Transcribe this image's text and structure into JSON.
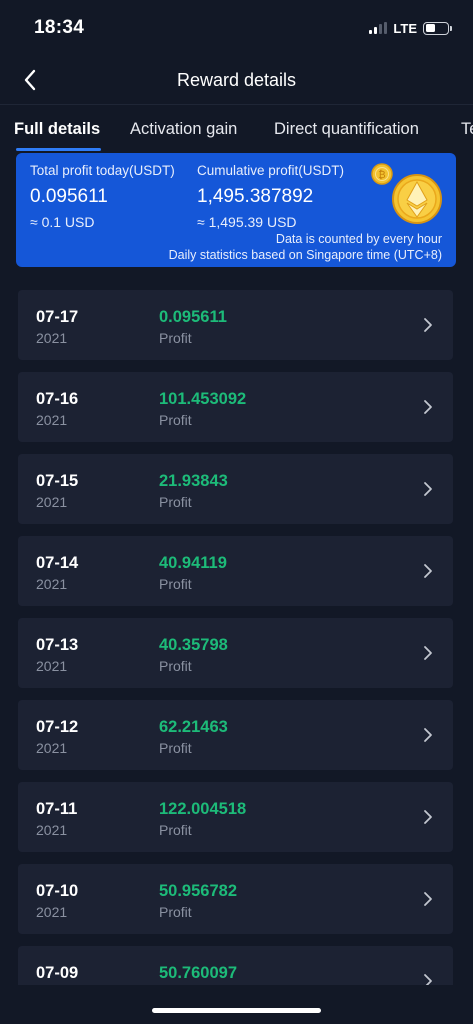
{
  "status": {
    "time": "18:34",
    "network": "LTE"
  },
  "nav": {
    "title": "Reward details"
  },
  "tabs": [
    {
      "label": "Full details"
    },
    {
      "label": "Activation gain"
    },
    {
      "label": "Direct quantification"
    },
    {
      "label": "Te"
    }
  ],
  "summary": {
    "today_label": "Total profit today(USDT)",
    "today_value": "0.095611",
    "today_usd": "≈ 0.1 USD",
    "cumulative_label": "Cumulative profit(USDT)",
    "cumulative_value": "1,495.387892",
    "cumulative_usd": "≈ 1,495.39 USD",
    "note_line1": "Data is counted by every hour",
    "note_line2": "Daily statistics based on Singapore time (UTC+8)"
  },
  "records": [
    {
      "date": "07-17",
      "year": "2021",
      "amount": "0.095611",
      "type": "Profit"
    },
    {
      "date": "07-16",
      "year": "2021",
      "amount": "101.453092",
      "type": "Profit"
    },
    {
      "date": "07-15",
      "year": "2021",
      "amount": "21.93843",
      "type": "Profit"
    },
    {
      "date": "07-14",
      "year": "2021",
      "amount": "40.94119",
      "type": "Profit"
    },
    {
      "date": "07-13",
      "year": "2021",
      "amount": "40.35798",
      "type": "Profit"
    },
    {
      "date": "07-12",
      "year": "2021",
      "amount": "62.21463",
      "type": "Profit"
    },
    {
      "date": "07-11",
      "year": "2021",
      "amount": "122.004518",
      "type": "Profit"
    },
    {
      "date": "07-10",
      "year": "2021",
      "amount": "50.956782",
      "type": "Profit"
    },
    {
      "date": "07-09",
      "year": "",
      "amount": "50.760097",
      "type": ""
    }
  ],
  "colors": {
    "background": "#121826",
    "card": "#1c2233",
    "summary_card": "#1557d8",
    "profit_green": "#1dbb79",
    "tab_indicator": "#2f7cf6"
  },
  "icons": {
    "back": "chevron-left-icon",
    "row": "chevron-right-icon",
    "coins": "coins-icon"
  }
}
